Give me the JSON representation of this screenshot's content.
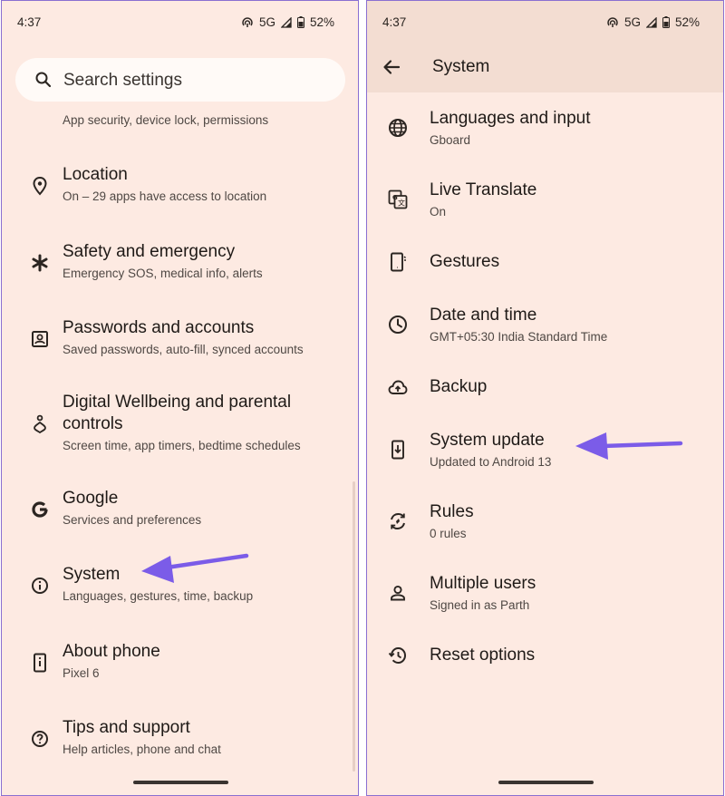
{
  "colors": {
    "background": "#fdeae2",
    "accent_arrow": "#7b5ce8",
    "border": "#8a6fd1"
  },
  "left": {
    "status": {
      "time": "4:37",
      "network": "5G",
      "battery": "52%"
    },
    "search": {
      "placeholder": "Search settings",
      "icon": "search-icon"
    },
    "clipped_subtitle": "App security, device lock, permissions",
    "items": [
      {
        "title": "Location",
        "subtitle": "On – 29 apps have access to location",
        "icon": "location-pin-icon"
      },
      {
        "title": "Safety and emergency",
        "subtitle": "Emergency SOS, medical info, alerts",
        "icon": "asterisk-icon"
      },
      {
        "title": "Passwords and accounts",
        "subtitle": "Saved passwords, auto-fill, synced accounts",
        "icon": "account-box-icon"
      },
      {
        "title": "Digital Wellbeing and parental",
        "title2": "controls",
        "subtitle": "Screen time, app timers, bedtime schedules",
        "icon": "wellbeing-icon"
      },
      {
        "title": "Google",
        "subtitle": "Services and preferences",
        "icon": "google-icon"
      },
      {
        "title": "System",
        "subtitle": "Languages, gestures, time, backup",
        "icon": "info-icon"
      },
      {
        "title": "About phone",
        "subtitle": "Pixel 6",
        "icon": "phone-info-icon"
      },
      {
        "title": "Tips and support",
        "subtitle": "Help articles, phone and chat",
        "icon": "help-icon"
      }
    ]
  },
  "right": {
    "status": {
      "time": "4:37",
      "network": "5G",
      "battery": "52%"
    },
    "app_bar": {
      "title": "System",
      "back_icon": "back-arrow-icon"
    },
    "items": [
      {
        "title": "Languages and input",
        "subtitle": "Gboard",
        "icon": "globe-icon"
      },
      {
        "title": "Live Translate",
        "subtitle": "On",
        "icon": "translate-icon"
      },
      {
        "title": "Gestures",
        "subtitle": "",
        "icon": "gestures-icon"
      },
      {
        "title": "Date and time",
        "subtitle": "GMT+05:30 India Standard Time",
        "icon": "clock-icon"
      },
      {
        "title": "Backup",
        "subtitle": "",
        "icon": "cloud-upload-icon"
      },
      {
        "title": "System update",
        "subtitle": "Updated to Android 13",
        "icon": "system-update-icon"
      },
      {
        "title": "Rules",
        "subtitle": "0 rules",
        "icon": "rules-icon"
      },
      {
        "title": "Multiple users",
        "subtitle": "Signed in as Parth",
        "icon": "person-icon"
      },
      {
        "title": "Reset options",
        "subtitle": "",
        "icon": "history-icon"
      }
    ]
  }
}
